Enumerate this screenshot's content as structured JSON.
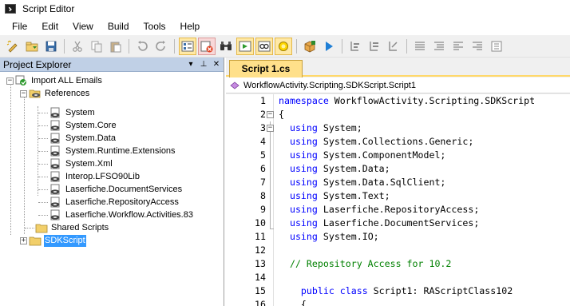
{
  "window": {
    "title": "Script Editor"
  },
  "menu": [
    "File",
    "Edit",
    "View",
    "Build",
    "Tools",
    "Help"
  ],
  "toolbar": {
    "buttons": [
      "new-script-icon",
      "add-reference-icon",
      "save-icon",
      "cut-icon",
      "copy-icon",
      "paste-icon",
      "undo-icon",
      "redo-icon",
      "properties-icon",
      "delete-icon",
      "find-icon",
      "build-icon",
      "debug-icon",
      "references-view-icon",
      "package-icon",
      "run-icon",
      "step-into-icon",
      "step-over-icon",
      "step-out-icon",
      "comment-icon",
      "uncomment-icon",
      "indent-icon",
      "outdent-icon",
      "toggle-view-icon"
    ]
  },
  "explorer": {
    "title": "Project Explorer",
    "pin_label": "▾ ⊥ ×",
    "root": "Import ALL Emails",
    "references_label": "References",
    "references": [
      "System",
      "System.Core",
      "System.Data",
      "System.Runtime.Extensions",
      "System.Xml",
      "Interop.LFSO90Lib",
      "Laserfiche.DocumentServices",
      "Laserfiche.RepositoryAccess",
      "Laserfiche.Workflow.Activities.83"
    ],
    "shared_scripts": "Shared Scripts",
    "sdk_script": "SDKScript"
  },
  "editor": {
    "tab": "Script 1.cs",
    "navbar": "WorkflowActivity.Scripting.SDKScript.Script1",
    "lines": [
      {
        "n": "1",
        "kw": "namespace",
        "rest": " WorkflowActivity.Scripting.SDKScript"
      },
      {
        "n": "2",
        "kw": "",
        "rest": "{"
      },
      {
        "n": "3",
        "kw": "  using",
        "rest": " System;"
      },
      {
        "n": "4",
        "kw": "  using",
        "rest": " System.Collections.Generic;"
      },
      {
        "n": "5",
        "kw": "  using",
        "rest": " System.ComponentModel;"
      },
      {
        "n": "6",
        "kw": "  using",
        "rest": " System.Data;"
      },
      {
        "n": "7",
        "kw": "  using",
        "rest": " System.Data.SqlClient;"
      },
      {
        "n": "8",
        "kw": "  using",
        "rest": " System.Text;"
      },
      {
        "n": "9",
        "kw": "  using",
        "rest": " Laserfiche.RepositoryAccess;"
      },
      {
        "n": "10",
        "kw": "  using",
        "rest": " Laserfiche.DocumentServices;"
      },
      {
        "n": "11",
        "kw": "  using",
        "rest": " System.IO;"
      },
      {
        "n": "12",
        "kw": "",
        "rest": ""
      },
      {
        "n": "13",
        "cm": "  // Repository Access for 10.2"
      },
      {
        "n": "14",
        "kw": "",
        "rest": ""
      },
      {
        "n": "15",
        "kw": "    public class",
        "rest": " Script1: RAScriptClass102"
      },
      {
        "n": "16",
        "kw": "",
        "rest": "    {"
      }
    ]
  }
}
